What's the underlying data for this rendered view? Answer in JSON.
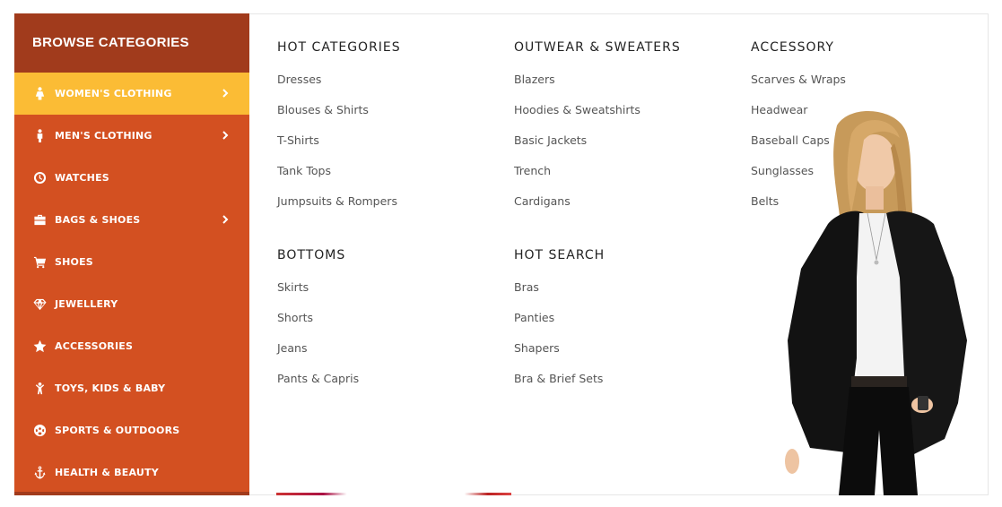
{
  "sidebar": {
    "title": "BROWSE CATEGORIES",
    "items": [
      {
        "label": "WOMEN'S CLOTHING",
        "icon": "female-icon",
        "has_submenu": true,
        "active": true
      },
      {
        "label": "MEN'S CLOTHING",
        "icon": "male-icon",
        "has_submenu": true,
        "active": false
      },
      {
        "label": "WATCHES",
        "icon": "clock-icon",
        "has_submenu": false,
        "active": false
      },
      {
        "label": "BAGS & SHOES",
        "icon": "briefcase-icon",
        "has_submenu": true,
        "active": false
      },
      {
        "label": "SHOES",
        "icon": "cart-icon",
        "has_submenu": false,
        "active": false
      },
      {
        "label": "JEWELLERY",
        "icon": "diamond-icon",
        "has_submenu": false,
        "active": false
      },
      {
        "label": "ACCESSORIES",
        "icon": "star-icon",
        "has_submenu": false,
        "active": false
      },
      {
        "label": "TOYS, KIDS & BABY",
        "icon": "child-icon",
        "has_submenu": false,
        "active": false
      },
      {
        "label": "SPORTS & OUTDOORS",
        "icon": "soccer-ball-icon",
        "has_submenu": false,
        "active": false
      },
      {
        "label": "HEALTH & BEAUTY",
        "icon": "anchor-icon",
        "has_submenu": false,
        "active": false
      }
    ]
  },
  "menu": {
    "hot_categories": {
      "title": "HOT CATEGORIES",
      "links": [
        "Dresses",
        "Blouses & Shirts",
        "T-Shirts",
        "Tank Tops",
        "Jumpsuits & Rompers"
      ]
    },
    "outwear": {
      "title": "OUTWEAR & SWEATERS",
      "links": [
        "Blazers",
        "Hoodies & Sweatshirts",
        "Basic Jackets",
        "Trench",
        "Cardigans"
      ]
    },
    "accessory": {
      "title": "ACCESSORY",
      "links": [
        "Scarves & Wraps",
        "Headwear",
        "Baseball Caps",
        "Sunglasses",
        "Belts"
      ]
    },
    "bottoms": {
      "title": "BOTTOMS",
      "links": [
        "Skirts",
        "Shorts",
        "Jeans",
        "Pants & Capris"
      ]
    },
    "hot_search": {
      "title": "HOT SEARCH",
      "links": [
        "Bras",
        "Panties",
        "Shapers",
        "Bra & Brief Sets"
      ]
    }
  },
  "colors": {
    "sidebar_bg": "#d35021",
    "sidebar_header_bg": "#a13b1c",
    "active_item_bg": "#fbbc35"
  }
}
